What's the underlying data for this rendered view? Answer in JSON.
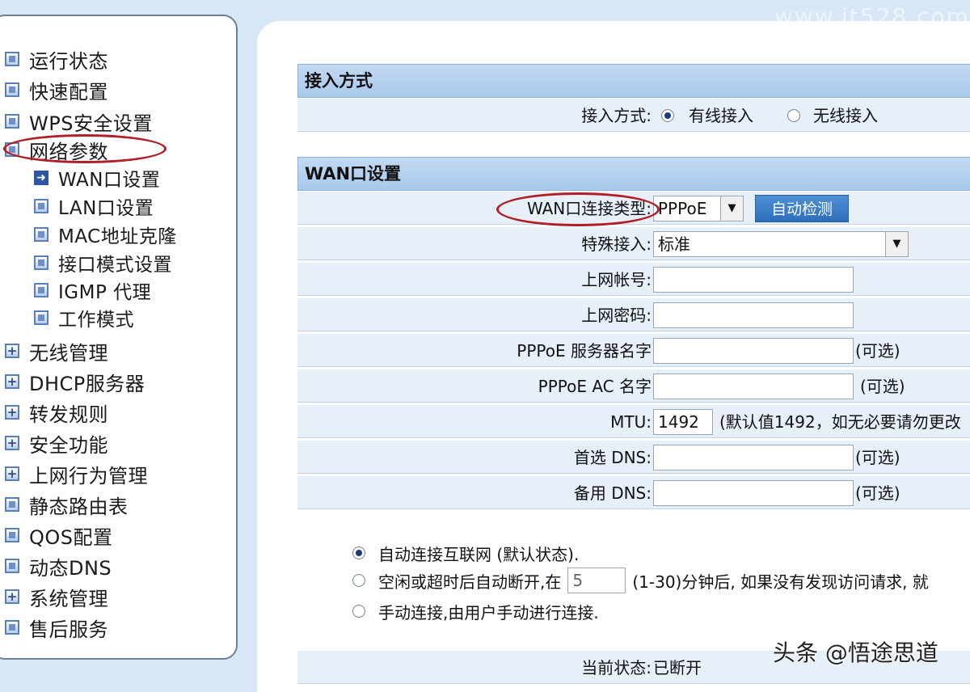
{
  "watermark_top": "www.it528.com",
  "sidebar": {
    "items": [
      {
        "label": "运行状态",
        "icon": "square-bullet-icon"
      },
      {
        "label": "快速配置",
        "icon": "square-bullet-icon"
      },
      {
        "label": "WPS安全设置",
        "icon": "square-bullet-icon"
      },
      {
        "label": "网络参数",
        "icon": "square-bullet-icon"
      },
      {
        "label": "WAN口设置",
        "icon": "arrow-right-icon"
      },
      {
        "label": "LAN口设置",
        "icon": "square-bullet-icon"
      },
      {
        "label": "MAC地址克隆",
        "icon": "square-bullet-icon"
      },
      {
        "label": "接口模式设置",
        "icon": "square-bullet-icon"
      },
      {
        "label": "IGMP 代理",
        "icon": "square-bullet-icon"
      },
      {
        "label": "工作模式",
        "icon": "square-bullet-icon"
      },
      {
        "label": "无线管理",
        "icon": "plus-box-icon"
      },
      {
        "label": "DHCP服务器",
        "icon": "plus-box-icon"
      },
      {
        "label": "转发规则",
        "icon": "plus-box-icon"
      },
      {
        "label": "安全功能",
        "icon": "plus-box-icon"
      },
      {
        "label": "上网行为管理",
        "icon": "plus-box-icon"
      },
      {
        "label": "静态路由表",
        "icon": "square-bullet-icon"
      },
      {
        "label": "QOS配置",
        "icon": "square-bullet-icon"
      },
      {
        "label": "动态DNS",
        "icon": "square-bullet-icon"
      },
      {
        "label": "系统管理",
        "icon": "plus-box-icon"
      },
      {
        "label": "售后服务",
        "icon": "square-bullet-icon"
      }
    ]
  },
  "access": {
    "title": "接入方式",
    "label": "接入方式:",
    "options": [
      "有线接入",
      "无线接入"
    ],
    "selected": 0
  },
  "wan": {
    "title": "WAN口设置",
    "conn_type_label": "WAN口连接类型:",
    "conn_type_value": "PPPoE",
    "detect_button": "自动检测",
    "special_label": "特殊接入:",
    "special_value": "标准",
    "account_label": "上网帐号:",
    "account_value": "",
    "password_label": "上网密码:",
    "password_value": "",
    "server_label": "PPPoE 服务器名字",
    "server_value": "",
    "ac_label": "PPPoE AC 名字",
    "ac_value": "",
    "mtu_label": "MTU:",
    "mtu_value": "1492",
    "mtu_note": "(默认值1492，如无必要请勿更改",
    "dns1_label": "首选 DNS:",
    "dns1_value": "",
    "dns2_label": "备用 DNS:",
    "dns2_value": "",
    "optional_note": "(可选)"
  },
  "connect_mode": {
    "options": [
      {
        "pre": "自动连接互联网 (默认状态).",
        "field": "",
        "post": ""
      },
      {
        "pre": "空闲或超时后自动断开,在",
        "field": "5",
        "post": "(1-30)分钟后, 如果没有发现访问请求, 就"
      },
      {
        "pre": "手动连接,由用户手动进行连接.",
        "field": "",
        "post": ""
      }
    ],
    "selected": 0
  },
  "status": {
    "label": "当前状态:",
    "value": "已断开"
  },
  "watermark_bottom": "头条 @悟途思道",
  "colors": {
    "annotation_circle": "#b01e27",
    "accent": "#2d6fb9"
  }
}
